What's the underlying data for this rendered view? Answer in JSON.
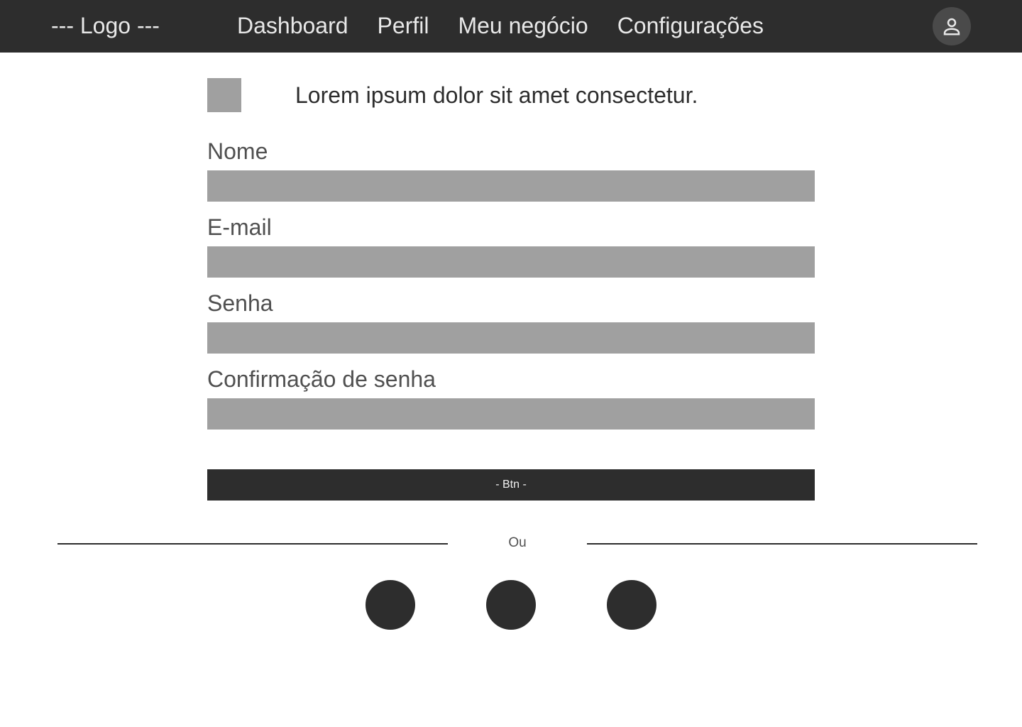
{
  "header": {
    "logo": "--- Logo ---",
    "nav": [
      {
        "label": "Dashboard"
      },
      {
        "label": "Perfil"
      },
      {
        "label": "Meu negócio"
      },
      {
        "label": "Configurações"
      }
    ],
    "avatar_icon": "user-icon"
  },
  "main": {
    "headline": "Lorem ipsum dolor sit amet consectetur.",
    "fields": [
      {
        "label": "Nome",
        "value": ""
      },
      {
        "label": "E-mail",
        "value": ""
      },
      {
        "label": "Senha",
        "value": ""
      },
      {
        "label": "Confirmação de senha",
        "value": ""
      }
    ],
    "button_label": "- Btn -",
    "divider_text": "Ou"
  },
  "colors": {
    "dark": "#2d2d2d",
    "placeholder_gray": "#a0a0a0",
    "white": "#ffffff"
  }
}
